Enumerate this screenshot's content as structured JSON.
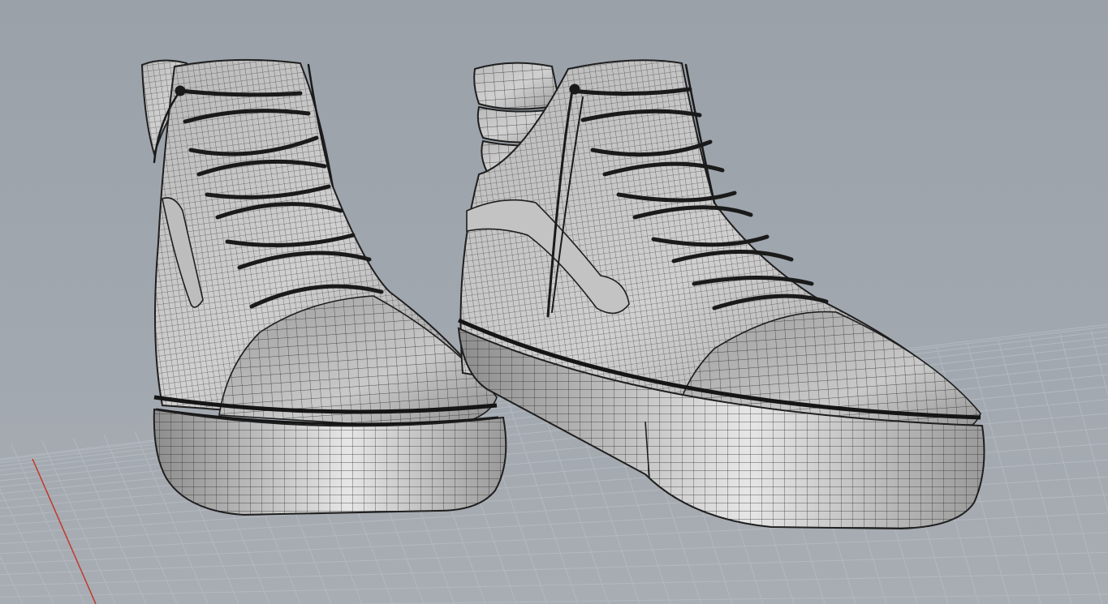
{
  "viewport": {
    "projection": "perspective",
    "display_mode": "wireframe-shaded",
    "background_color": "#9aa1a9",
    "grid_color": "#b3b9bf",
    "x_axis_color": "#c0392b",
    "object_color": "#c7c7c7",
    "mesh_line_color": "#2a2a2a"
  },
  "scene": {
    "objects": [
      "high-top-sneaker-left",
      "high-top-sneaker-right"
    ]
  }
}
